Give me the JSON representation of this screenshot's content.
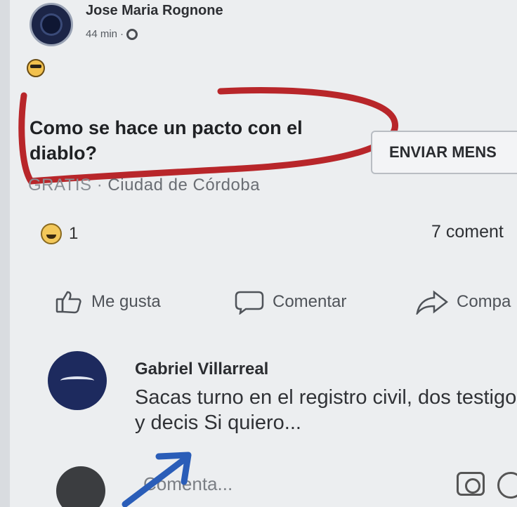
{
  "post": {
    "author": "Jose Maria Rognone",
    "time": "44 min",
    "text": "Como se hace un pacto con el diablo?",
    "sub_line": "Ciudad de Córdoba",
    "sub_line_cut": "GRATIS ·",
    "send_button": "ENVIAR MENS",
    "reaction_count": "1",
    "comments_count": "7 coment"
  },
  "actions": {
    "like": "Me gusta",
    "comment": "Comentar",
    "share": "Compa"
  },
  "comment": {
    "name": "Gabriel Villarreal",
    "text": "Sacas turno en el registro civil, dos testigos y decis Si quiero..."
  },
  "reply": {
    "placeholder": "Comenta..."
  },
  "colors": {
    "annotation_red": "#b8262a",
    "annotation_blue": "#2a5db8"
  },
  "icons": {
    "globe": "globe-icon",
    "like": "thumbs-up-icon",
    "comment": "speech-bubble-icon",
    "share": "share-arrow-icon",
    "camera": "camera-icon"
  }
}
